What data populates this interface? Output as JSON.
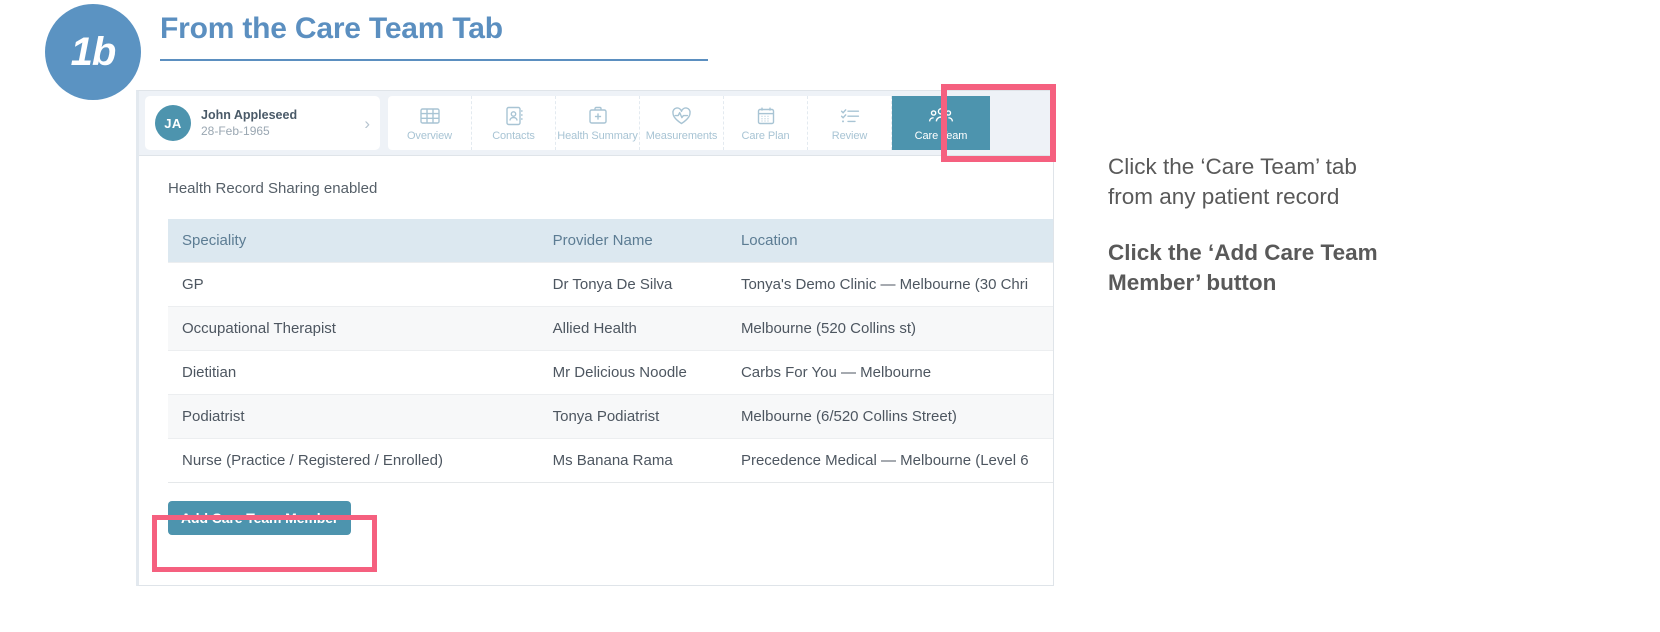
{
  "step": {
    "badge": "1b",
    "title": "From the Care Team Tab"
  },
  "colors": {
    "accent_blue": "#5b8fc0",
    "badge_blue": "#5b93c2",
    "teal": "#4d94ae",
    "highlight_pink": "#f5607f",
    "table_header_bg": "#dce8f0"
  },
  "app": {
    "patient": {
      "initials": "JA",
      "name": "John Appleseed",
      "dob": "28-Feb-1965",
      "chevron": "›"
    },
    "tabs": [
      {
        "label": "Overview",
        "icon": "grid-icon",
        "active": false
      },
      {
        "label": "Contacts",
        "icon": "contact-card-icon",
        "active": false
      },
      {
        "label": "Health Summary",
        "icon": "medical-kit-icon",
        "active": false
      },
      {
        "label": "Measurements",
        "icon": "heart-pulse-icon",
        "active": false
      },
      {
        "label": "Care Plan",
        "icon": "calendar-icon",
        "active": false
      },
      {
        "label": "Review",
        "icon": "checklist-icon",
        "active": false
      },
      {
        "label": "Care Team",
        "icon": "people-group-icon",
        "active": true
      }
    ],
    "sharing_note": "Health Record Sharing enabled",
    "table": {
      "columns": [
        "Speciality",
        "Provider Name",
        "Location"
      ],
      "rows": [
        [
          "GP",
          "Dr Tonya De Silva",
          "Tonya's Demo Clinic — Melbourne (30 Chri"
        ],
        [
          "Occupational Therapist",
          "Allied Health",
          "Melbourne (520 Collins st)"
        ],
        [
          "Dietitian",
          "Mr Delicious Noodle",
          "Carbs For You — Melbourne"
        ],
        [
          "Podiatrist",
          "Tonya Podiatrist",
          "Melbourne (6/520 Collins Street)"
        ],
        [
          "Nurse (Practice / Registered / Enrolled)",
          "Ms Banana Rama",
          "Precedence Medical — Melbourne (Level 6"
        ]
      ]
    },
    "add_button": "Add Care Team Member"
  },
  "instructions": [
    {
      "line1": "Click the ‘Care Team’ tab",
      "line2": "from any patient record",
      "bold": false
    },
    {
      "line1": "Click the ‘Add Care Team",
      "line2": "Member’ button",
      "bold": true
    }
  ]
}
